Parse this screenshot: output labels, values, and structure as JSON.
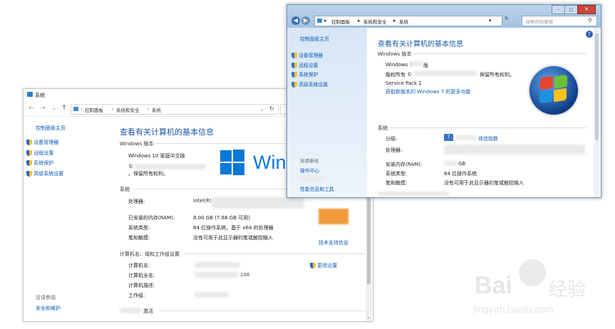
{
  "win10": {
    "title": "系统",
    "breadcrumb": [
      "控制面板",
      "系统和安全",
      "系统"
    ],
    "left_nav": {
      "home": "控制面板主页",
      "items": [
        "设备管理器",
        "远程设置",
        "系统保护",
        "高级系统设置"
      ],
      "see_also_title": "另请参阅",
      "see_also": [
        "安全和维护"
      ]
    },
    "heading": "查看有关计算机的基本信息",
    "edition_section": "Windows 版本",
    "edition": "Windows 10 家庭中文版",
    "copyright_prefix": "©",
    "rights": "。保留所有权利。",
    "logo_text": "Win",
    "system_section": "系统",
    "rows": [
      {
        "label": "处理器:",
        "value": "Intel(R)"
      },
      {
        "label": "已安装的内存(RAM):",
        "value": "8.00 GB (7.88 GB 可用)"
      },
      {
        "label": "系统类型:",
        "value": "64 位操作系统，基于 x64 的处理器"
      },
      {
        "label": "笔和触摸:",
        "value": "没有可用于此显示器的笔或触控输入"
      }
    ],
    "support_link": "技术支持信息",
    "computer_section": "计算机名、域和工作组设置",
    "computer_rows": [
      {
        "label": "计算机名:"
      },
      {
        "label": "计算机全名:",
        "value": "208"
      },
      {
        "label": "计算机描述:"
      },
      {
        "label": "工作组:"
      }
    ],
    "change_settings": "更改设置",
    "activation_section": "激活"
  },
  "win7": {
    "breadcrumb": [
      "控制面板",
      "系统和安全",
      "系统"
    ],
    "search_placeholder": "搜索控制面板",
    "left_nav": {
      "home": "控制面板主页",
      "items": [
        "设备管理器",
        "远程设置",
        "系统保护",
        "高级系统设置"
      ],
      "see_also_title": "另请参阅",
      "see_also": [
        "操作中心",
        "性能信息和工具"
      ]
    },
    "heading": "查看有关计算机的基本信息",
    "edition_section": "Windows 版本",
    "edition": "Windows 7",
    "edition_suffix": "版",
    "rights_prefix": "版权所有 ©",
    "rights_suffix": "保留所有权利。",
    "service_pack": "Service Pack 1",
    "more_features_link": "获取新版本的 Windows 7 的更多功能",
    "system_section": "系统",
    "rating_label": "分级:",
    "rating_link": "体验指数",
    "rows": [
      {
        "label": "处理器:"
      },
      {
        "label": "安装内存(RAM):",
        "value": "GB"
      },
      {
        "label": "系统类型:",
        "value": "64 位操作系统"
      },
      {
        "label": "笔和触摸:",
        "value": "没有可用于此显示器的笔或触控输入"
      }
    ]
  },
  "watermark": {
    "brand": "Bai",
    "brand2": "经验",
    "url": "jingyan.baidu.com"
  },
  "colors": {
    "link": "#0b5bb8",
    "heading": "#1a58a6",
    "win10_blue": "#0a78d7",
    "orange": "#f39a3c",
    "win7_chrome": "#a6c2e0"
  }
}
